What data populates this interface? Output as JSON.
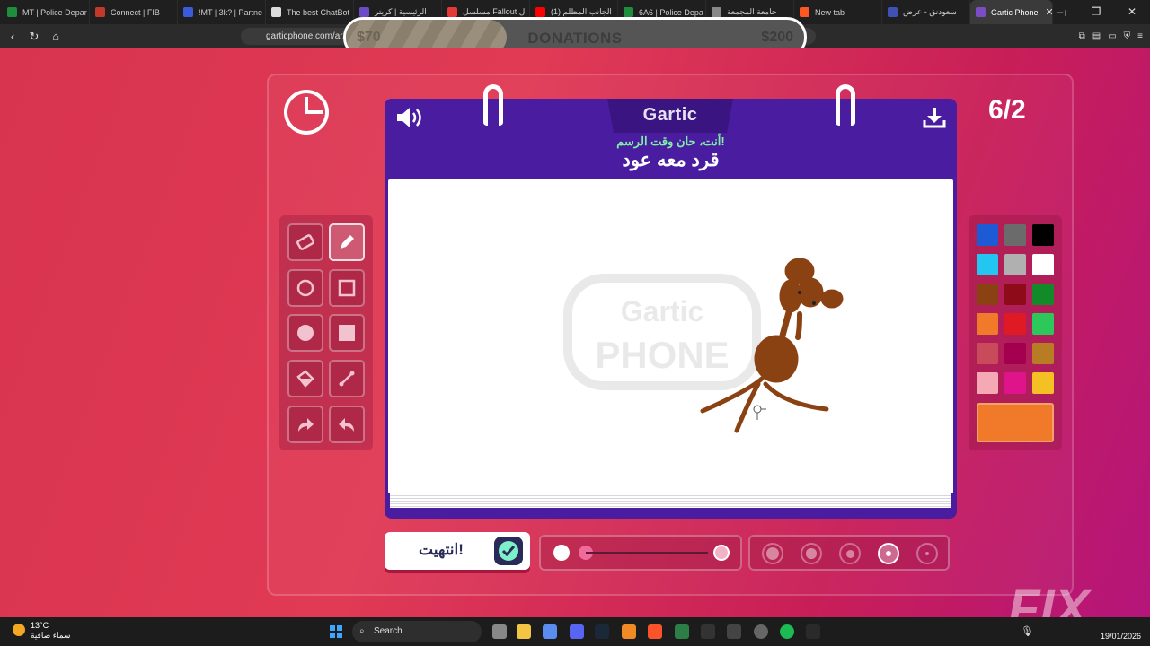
{
  "browser": {
    "tabs": [
      {
        "label": "MT | Police Depar",
        "fav": "#1e8e3e"
      },
      {
        "label": "Connect | FIB",
        "fav": "#c0392b"
      },
      {
        "label": "!MT | 3k? | Partne",
        "fav": "#3b5bdb"
      },
      {
        "label": "The best ChatBot",
        "fav": "#dddddd"
      },
      {
        "label": "الرئيسية | كريتر",
        "fav": "#6c4cc6"
      },
      {
        "label": "مسلسل Fallout ال",
        "fav": "#e53935"
      },
      {
        "label": "(1) الجانب المظلم",
        "fav": "#ff0000"
      },
      {
        "label": "6A6 | Police Depa",
        "fav": "#1e8e3e"
      },
      {
        "label": "جامعة المجمعة",
        "fav": "#888888"
      },
      {
        "label": "New tab",
        "fav": "#ff5722"
      },
      {
        "label": "سعودنق - عرض",
        "fav": "#3f51b5"
      },
      {
        "label": "Gartic Phone",
        "fav": "#7b4cc6",
        "active": true
      }
    ],
    "new_tab": "+",
    "url": "garticphone.com/ar/"
  },
  "donation": {
    "label": "DONATIONS",
    "current": "$70",
    "goal": "$200",
    "progress_fraction": 0.35
  },
  "game": {
    "logo": "Gartic",
    "prompt_title": "أنت، حان وقت الرسم!",
    "prompt_word": "قرد معه عود",
    "round": "6/2",
    "watermark_top": "Gartic",
    "watermark_bottom": "PHONE",
    "done_label": "انتهيت!",
    "tools": [
      "eraser-icon",
      "pencil-icon",
      "circle-outline-icon",
      "square-outline-icon",
      "circle-filled-icon",
      "square-filled-icon",
      "bucket-icon",
      "line-icon",
      "redo-icon",
      "undo-icon"
    ],
    "selected_tool": "pencil-icon",
    "palette": [
      "#1c5ad6",
      "#6b6b6b",
      "#000000",
      "#23c6f0",
      "#b0b0b0",
      "#ffffff",
      "#8a4213",
      "#8e0b1a",
      "#138a2a",
      "#f07a2a",
      "#e01a24",
      "#2ec85a",
      "#c94a5a",
      "#a3004f",
      "#b87d24",
      "#f5a9b5",
      "#e0148a",
      "#f5c023"
    ],
    "current_color": "#f07a2a",
    "brush_sizes": 5,
    "selected_size": 4,
    "opacity_fraction": 1.0
  },
  "taskbar": {
    "weather_temp": "13°C",
    "weather_text": "سماء صافية",
    "search": "Search",
    "date": "19/01/2026"
  },
  "colors": {
    "accent_purple": "#4a1da0",
    "background_red": "#d8334f"
  }
}
